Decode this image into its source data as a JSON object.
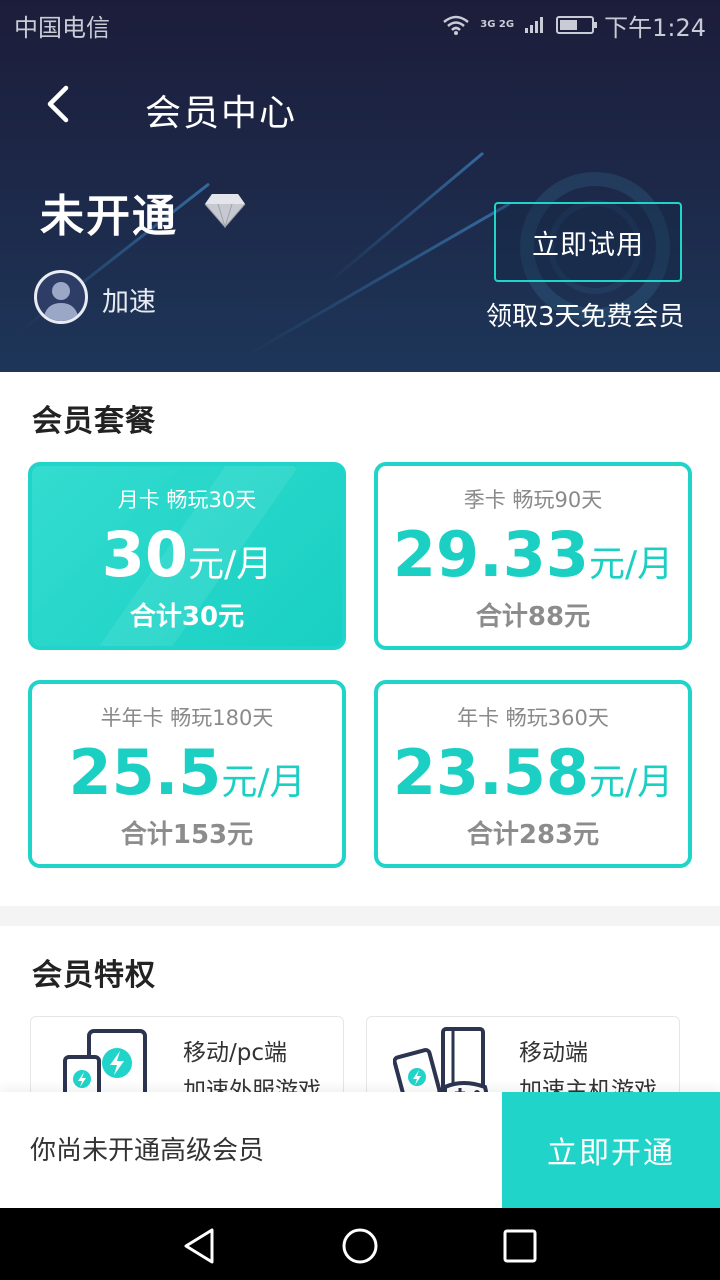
{
  "status_bar": {
    "carrier": "中国电信",
    "network": "3G 2G",
    "time": "下午1:24",
    "battery_fill": 0.55
  },
  "header": {
    "title": "会员中心"
  },
  "membership": {
    "status": "未开通",
    "username": "加速",
    "trial_button": "立即试用",
    "trial_note": "领取3天免费会员"
  },
  "plans": {
    "title": "会员套餐",
    "items": [
      {
        "name": "月卡 畅玩30天",
        "price": "30",
        "unit": "元/月",
        "total": "合计30元",
        "selected": true
      },
      {
        "name": "季卡 畅玩90天",
        "price": "29.33",
        "unit": "元/月",
        "total": "合计88元",
        "selected": false
      },
      {
        "name": "半年卡 畅玩180天",
        "price": "25.5",
        "unit": "元/月",
        "total": "合计153元",
        "selected": false
      },
      {
        "name": "年卡 畅玩360天",
        "price": "23.58",
        "unit": "元/月",
        "total": "合计283元",
        "selected": false
      }
    ]
  },
  "privileges": {
    "title": "会员特权",
    "items": [
      {
        "line1": "移动/pc端",
        "line2": "加速外服游戏",
        "icon": "devices-icon"
      },
      {
        "line1": "移动端",
        "line2": "加速主机游戏",
        "icon": "console-icon"
      }
    ]
  },
  "bottom_bar": {
    "hint": "你尚未开通高级会员",
    "button": "立即开通"
  },
  "colors": {
    "accent": "#21d4c9",
    "header_bg": "#1d2747"
  }
}
